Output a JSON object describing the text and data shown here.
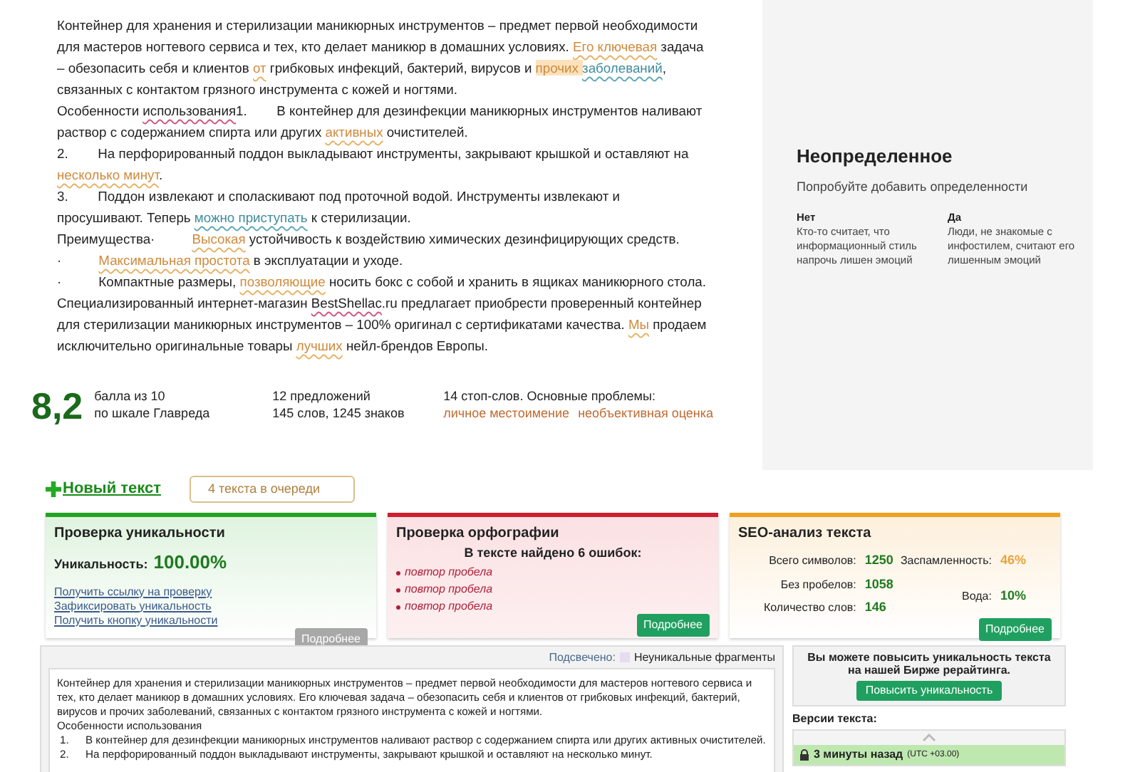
{
  "article": {
    "paragraphs": [
      {
        "segments": [
          {
            "text": "Контейнер для хранения и стерилизации маникюрных инструментов – предмет первой необходимости для мастеров ногтевого сервиса и тех, кто делает маникюр в домашних условиях. ",
            "kind": "plain"
          },
          {
            "text": "Его ключевая",
            "kind": "warn"
          },
          {
            "text": " задача – обезопасить себя и клиентов ",
            "kind": "plain"
          },
          {
            "text": "от",
            "kind": "warn"
          },
          {
            "text": " грибковых инфекций, бактерий, вирусов и ",
            "kind": "plain"
          },
          {
            "text": "прочих ",
            "kind": "strong"
          },
          {
            "text": "заболеваний",
            "kind": "info"
          },
          {
            "text": ", связанных с контактом грязного инструмента с кожей и ногтями.",
            "kind": "plain"
          }
        ]
      },
      {
        "segments": [
          {
            "text": "Особенности ",
            "kind": "plain"
          },
          {
            "text": "использования",
            "kind": "spell"
          },
          {
            "text": "1.        В контейнер для дезинфекции маникюрных инструментов наливают раствор с содержанием спирта или других ",
            "kind": "plain"
          },
          {
            "text": "активных",
            "kind": "warn"
          },
          {
            "text": " очистителей.",
            "kind": "plain"
          }
        ]
      },
      {
        "segments": [
          {
            "text": "2.        На перфорированный поддон выкладывают инструменты, закрывают крышкой и оставляют на ",
            "kind": "plain"
          },
          {
            "text": "несколько минут",
            "kind": "warn"
          },
          {
            "text": ".",
            "kind": "plain"
          }
        ]
      },
      {
        "segments": [
          {
            "text": "3.        Поддон извлекают и споласкивают под проточной водой. Инструменты извлекают и просушивают. Теперь ",
            "kind": "plain"
          },
          {
            "text": "можно приступать",
            "kind": "info"
          },
          {
            "text": " к стерилизации.",
            "kind": "plain"
          }
        ]
      },
      {
        "segments": [
          {
            "text": "Преимущества·          ",
            "kind": "plain"
          },
          {
            "text": "Высокая",
            "kind": "warn"
          },
          {
            "text": " устойчивость к воздействию химических дезинфицирующих средств.",
            "kind": "plain"
          }
        ]
      },
      {
        "segments": [
          {
            "text": "·          ",
            "kind": "plain"
          },
          {
            "text": "Максимальная простота",
            "kind": "warn"
          },
          {
            "text": " в эксплуатации и уходе.",
            "kind": "plain"
          }
        ]
      },
      {
        "segments": [
          {
            "text": "·          Компактные размеры, ",
            "kind": "plain"
          },
          {
            "text": "позволяющие",
            "kind": "warn"
          },
          {
            "text": " носить бокс с собой и хранить в ящиках маникюрного стола.",
            "kind": "plain"
          }
        ]
      },
      {
        "segments": [
          {
            "text": "Специализированный интернет-магазин ",
            "kind": "plain"
          },
          {
            "text": "BestShellac",
            "kind": "spell"
          },
          {
            "text": ".ru предлагает приобрести проверенный контейнер для стерилизации маникюрных инструментов – 100% оригинал с сертификатами качества. ",
            "kind": "plain"
          },
          {
            "text": "Мы",
            "kind": "warn"
          },
          {
            "text": " продаем исключительно оригинальные товары ",
            "kind": "plain"
          },
          {
            "text": "лучших",
            "kind": "warn"
          },
          {
            "text": " нейл-брендов Европы.",
            "kind": "plain"
          }
        ]
      }
    ]
  },
  "hint_panel": {
    "title": "Неопределенное",
    "subtitle": "Попробуйте добавить определенности",
    "columns": [
      {
        "heading": "Нет",
        "text": "Кто-то считает, что информационный стиль напрочь лишен эмоций"
      },
      {
        "heading": "Да",
        "text": "Люди, не знакомые с инфостилем, считают его лишенным эмоций"
      }
    ]
  },
  "score": {
    "value": "8,2",
    "value_lines": [
      "балла из 10",
      "по шкале Главреда"
    ],
    "stats": [
      "12 предложений",
      "145 слов, 1245 знаков"
    ],
    "problems_title": "14 стоп-слов. Основные проблемы:",
    "problems": [
      "личное местоимение",
      "необъективная оценка"
    ]
  },
  "new_text_link": "Новый текст",
  "queue_button": "4 текста в очереди",
  "cards": [
    {
      "kind": "uniqueness",
      "title": "Проверка уникальности",
      "label": "Уникальность:",
      "value": "100.00%",
      "links": [
        "Получить ссылку на проверку",
        "Зафиксировать уникальность",
        "Получить кнопку уникальности"
      ],
      "button": {
        "label": "Подробнее",
        "disabled": true
      }
    },
    {
      "kind": "spelling",
      "title": "Проверка орфографии",
      "summary": "В тексте найдено 6 ошибок:",
      "errors": [
        "повтор пробела",
        "повтор пробела",
        "повтор пробела"
      ],
      "button": {
        "label": "Подробнее",
        "disabled": false
      }
    },
    {
      "kind": "seo",
      "title": "SEO-анализ текста",
      "left_stats": [
        {
          "label": "Всего символов:",
          "value": "1250",
          "color": "#1f7a1f"
        },
        {
          "label": "Без пробелов:",
          "value": "1058",
          "color": "#1f7a1f"
        },
        {
          "label": "Количество слов:",
          "value": "146",
          "color": "#1f7a1f"
        }
      ],
      "right_stats": [
        {
          "label": "Заспамленность:",
          "value": "46%",
          "color": "#e8a33a"
        },
        {
          "label": "Вода:",
          "value": "10%",
          "color": "#1f7a1f"
        }
      ],
      "button": {
        "label": "Подробнее",
        "disabled": false
      }
    }
  ],
  "report": {
    "highlight_label": "Подсвечено:",
    "legend": "Неуникальные фрагменты",
    "lines": [
      {
        "kind": "paragraph",
        "text": "Контейнер для хранения и стерилизации маникюрных инструментов – предмет первой необходимости для мастеров ногтевого сервиса и тех, кто делает маникюр в домашних условиях. Его ключевая задача – обезопасить себя и клиентов от грибковых инфекций, бактерий, вирусов и прочих заболеваний, связанных с контактом грязного инструмента с кожей и ногтями."
      },
      {
        "kind": "paragraph",
        "text": "Особенности использования"
      },
      {
        "kind": "numbered",
        "number": "1.",
        "text": "В контейнер для дезинфекции маникюрных инструментов наливают раствор с содержанием спирта или других активных очистителей."
      },
      {
        "kind": "numbered",
        "number": "2.",
        "text": "На перфорированный поддон выкладывают инструменты, закрывают крышкой и оставляют на несколько минут."
      }
    ]
  },
  "promo": {
    "text": "Вы можете повысить уникальность текста на нашей Бирже рерайтинга.",
    "button": "Повысить уникальность"
  },
  "versions": {
    "title": "Версии текста:",
    "items": [
      {
        "label": "3 минуты назад",
        "zone": "(UTC +03.00)",
        "selected": true
      }
    ]
  }
}
